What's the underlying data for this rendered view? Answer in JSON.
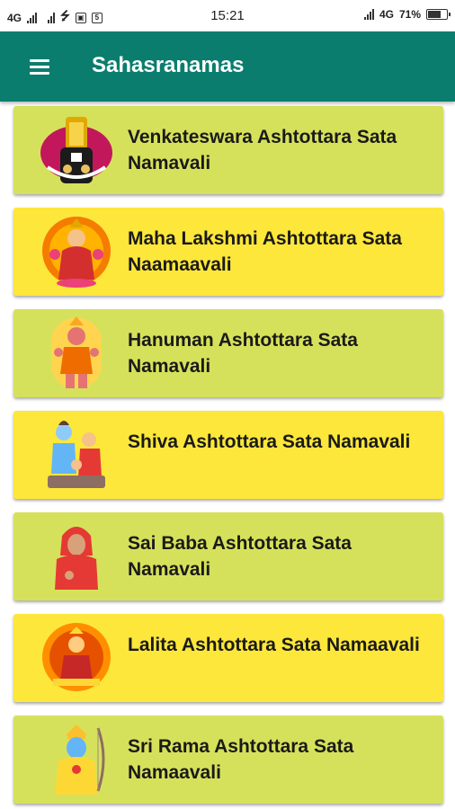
{
  "status": {
    "left_network": "4G",
    "time": "15:21",
    "right_network": "4G",
    "battery": "71%",
    "battery_level": 0.71
  },
  "appbar": {
    "title": "Sahasranamas",
    "menu_icon": "hamburger-menu-icon",
    "background": "#0b7d6e"
  },
  "items": [
    {
      "label": "Venkateswara Ashtottara Sata Namavali",
      "icon": "venkateswara-image",
      "color": "#d6e15b"
    },
    {
      "label": "Maha Lakshmi Ashtottara Sata Naamaavali",
      "icon": "lakshmi-image",
      "color": "#fde73a"
    },
    {
      "label": "Hanuman Ashtottara Sata Namavali",
      "icon": "hanuman-image",
      "color": "#d6e15b"
    },
    {
      "label": "Shiva Ashtottara Sata Namavali",
      "icon": "shiva-image",
      "color": "#fde73a"
    },
    {
      "label": "Sai Baba Ashtottara Sata Namavali",
      "icon": "sai-baba-image",
      "color": "#d6e15b"
    },
    {
      "label": "Lalita Ashtottara Sata Namaavali",
      "icon": "lalita-image",
      "color": "#fde73a"
    },
    {
      "label": "Sri Rama Ashtottara Sata Namaavali",
      "icon": "sri-rama-image",
      "color": "#d6e15b"
    }
  ]
}
